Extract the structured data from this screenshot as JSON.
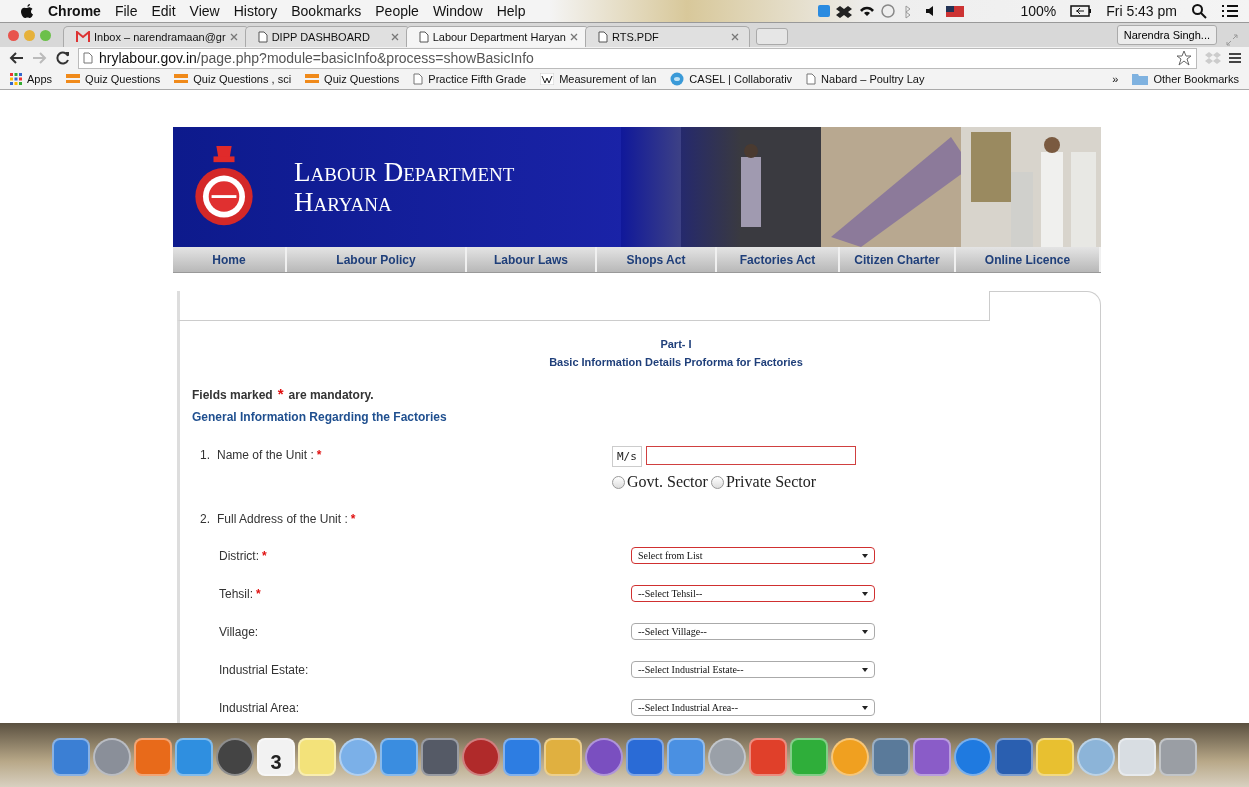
{
  "menu_bar": {
    "app": "Chrome",
    "items": [
      "File",
      "Edit",
      "View",
      "History",
      "Bookmarks",
      "People",
      "Window",
      "Help"
    ],
    "battery": "100%",
    "clock": "Fri 5:43 pm"
  },
  "tabs": [
    {
      "title": "Inbox – narendramaan@gr",
      "kind": "mail",
      "selected": false
    },
    {
      "title": "DIPP DASHBOARD",
      "kind": "page",
      "selected": false
    },
    {
      "title": "Labour Department Haryan",
      "kind": "page",
      "selected": true
    },
    {
      "title": "RTS.PDF",
      "kind": "page",
      "selected": false
    }
  ],
  "profile": "Narendra Singh...",
  "address": {
    "host": "hrylabour.gov.in",
    "path": "/page.php?module=basicInfo&process=showBasicInfo"
  },
  "bookmarks": [
    {
      "label": "Apps",
      "kind": "apps"
    },
    {
      "label": "Quiz Questions",
      "kind": "bar"
    },
    {
      "label": "Quiz Questions , sci",
      "kind": "bar"
    },
    {
      "label": "Quiz Questions",
      "kind": "bar"
    },
    {
      "label": "Practice Fifth Grade",
      "kind": "page"
    },
    {
      "label": "Measurement of lan",
      "kind": "wiki"
    },
    {
      "label": "CASEL | Collaborativ",
      "kind": "globe"
    },
    {
      "label": "Nabard – Poultry Lay",
      "kind": "page"
    }
  ],
  "bookmarks_more": "»",
  "other_bookmarks": "Other Bookmarks",
  "site": {
    "title": [
      "Labour Department",
      "Haryana"
    ],
    "nav": [
      "Home",
      "Labour Policy",
      "Labour Laws",
      "Shops Act",
      "Factories Act",
      "Citizen Charter",
      "Online Licence"
    ]
  },
  "form": {
    "part": "Part- I",
    "title": "Basic Information Details Proforma for Factories",
    "mandatory_note": {
      "before": "Fields marked",
      "mark": "*",
      "after": "are mandatory."
    },
    "section": "General Information Regarding the Factories",
    "fields": [
      {
        "kind": "name",
        "number": "1.",
        "label": "Name of the Unit :",
        "required": true,
        "prefix": "M/s",
        "options": [
          {
            "label": "Govt. Sector",
            "selected": false
          },
          {
            "label": "Private Sector",
            "selected": false
          }
        ]
      },
      {
        "kind": "heading",
        "number": "2.",
        "label": "Full Address of the Unit :",
        "required": true
      },
      {
        "kind": "select",
        "label": "District:",
        "required": true,
        "value": "Select from List"
      },
      {
        "kind": "select",
        "label": "Tehsil:",
        "required": true,
        "value": "--Select Tehsil--"
      },
      {
        "kind": "select",
        "label": "Village:",
        "required": false,
        "value": "--Select Village--"
      },
      {
        "kind": "select",
        "label": "Industrial Estate:",
        "required": false,
        "value": "--Select Industrial Estate--"
      },
      {
        "kind": "select",
        "label": "Industrial Area:",
        "required": false,
        "value": "--Select Industrial Area--"
      }
    ]
  },
  "dock": [
    {
      "color": "#3b7fd4"
    },
    {
      "color": "#8a8f99"
    },
    {
      "color": "#e86a1a"
    },
    {
      "color": "#2f8fe0"
    },
    {
      "color": "#444444"
    },
    {
      "color": "#f2f2f2",
      "label": "3"
    },
    {
      "color": "#f3e27a"
    },
    {
      "color": "#7bb0e8"
    },
    {
      "color": "#3a8de0"
    },
    {
      "color": "#555a66"
    },
    {
      "color": "#b02a2a"
    },
    {
      "color": "#2d7de2"
    },
    {
      "color": "#e0b040"
    },
    {
      "color": "#7a4fc0"
    },
    {
      "color": "#2a6bd6"
    },
    {
      "color": "#4a90e2"
    },
    {
      "color": "#9aa0a8"
    },
    {
      "color": "#e0402a"
    },
    {
      "color": "#2fae3a"
    },
    {
      "color": "#f0a020"
    },
    {
      "color": "#5a7a9a"
    },
    {
      "color": "#8a5cc8"
    },
    {
      "color": "#1f7ae0"
    },
    {
      "color": "#2a5fb0"
    },
    {
      "color": "#e8c030"
    },
    {
      "color": "#8cb4d8"
    },
    {
      "color": "#d8dde2"
    },
    {
      "color": "#9a9ea4"
    }
  ]
}
